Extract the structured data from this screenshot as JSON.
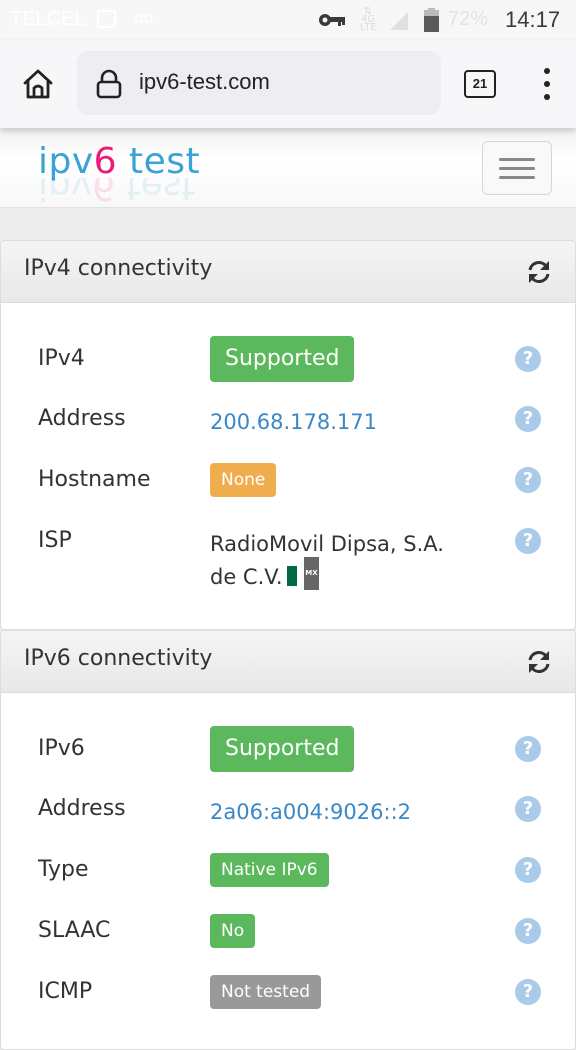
{
  "status_bar": {
    "carrier": "TELCEL",
    "network": "4G LTE",
    "battery": "72%",
    "time": "14:17"
  },
  "browser": {
    "url": "ipv6-test.com",
    "tab_count": "21"
  },
  "site": {
    "logo_prefix": "ipv",
    "logo_six": "6",
    "logo_suffix": " test"
  },
  "ipv4_panel": {
    "title": "IPv4 connectivity",
    "rows": [
      {
        "label": "IPv4",
        "value": "Supported",
        "kind": "badge-success-lg"
      },
      {
        "label": "Address",
        "value": "200.68.178.171",
        "kind": "link"
      },
      {
        "label": "Hostname",
        "value": "None",
        "kind": "badge-warning"
      },
      {
        "label": "ISP",
        "value_line1": "RadioMovil Dipsa, S.A.",
        "value_line2": "de C.V.",
        "flag": "MX",
        "kind": "text"
      }
    ]
  },
  "ipv6_panel": {
    "title": "IPv6 connectivity",
    "rows": [
      {
        "label": "IPv6",
        "value": "Supported",
        "kind": "badge-success-lg"
      },
      {
        "label": "Address",
        "value": "2a06:a004:9026::2",
        "kind": "link"
      },
      {
        "label": "Type",
        "value": "Native IPv6",
        "kind": "badge-success"
      },
      {
        "label": "SLAAC",
        "value": "No",
        "kind": "badge-success"
      },
      {
        "label": "ICMP",
        "value": "Not tested",
        "kind": "badge-default"
      }
    ]
  },
  "help_glyph": "?",
  "colors": {
    "success": "#5cb85c",
    "warning": "#f0ad4e",
    "default": "#999999",
    "link": "#3a87c8",
    "help": "#a9cbe9",
    "logo_blue": "#3aa3d4",
    "logo_pink": "#ec1b7a"
  }
}
